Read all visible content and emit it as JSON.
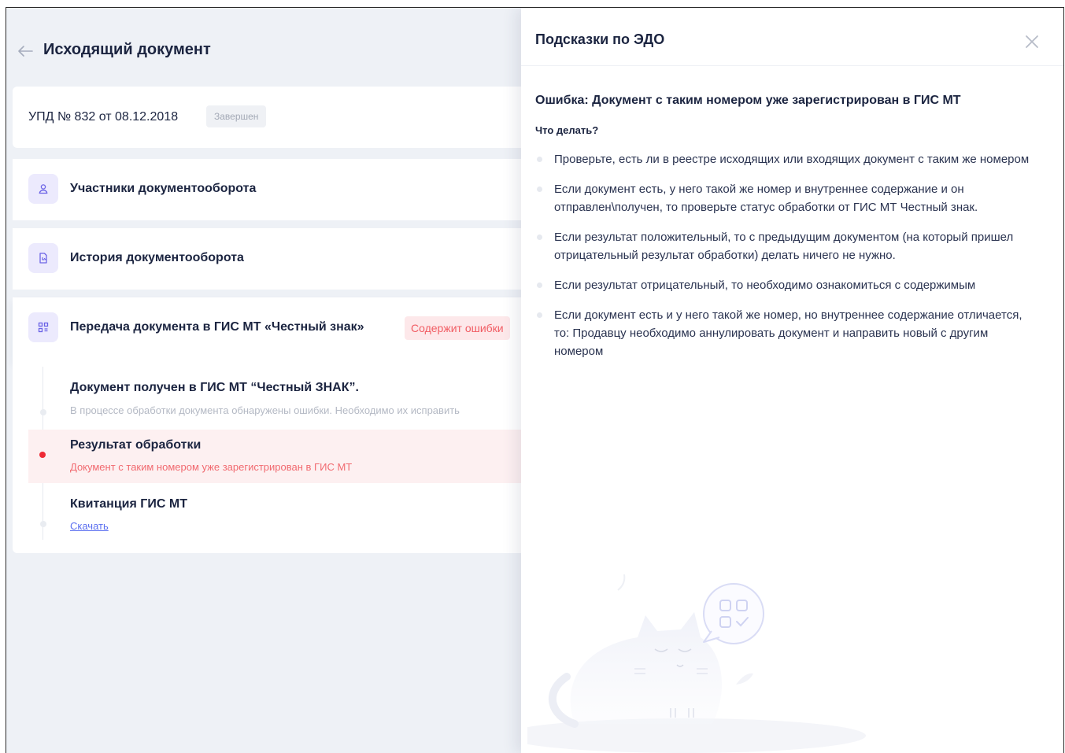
{
  "header": {
    "title": "Исходящий документ"
  },
  "document": {
    "number": "УПД № 832 от 08.12.2018",
    "status": "Завершен"
  },
  "sections": [
    {
      "label": "Участники документооборота",
      "icon": "user-icon"
    },
    {
      "label": "История документооборота",
      "icon": "document-history-icon"
    },
    {
      "label": "Передача документа в ГИС МТ «Честный знак»",
      "icon": "qr-code-icon",
      "badge": "Содержит ошибки"
    }
  ],
  "steps": [
    {
      "title": "Документ получен в ГИС МТ “Честный ЗНАК”.",
      "subtitle": "В процессе обработки документа обнаружены ошибки. Необходимо их исправить"
    },
    {
      "title": "Результат обработки",
      "subtitle": "Документ с таким номером уже  зарегистрирован в ГИС МТ"
    },
    {
      "title": "Квитанция ГИС МТ",
      "link": "Скачать"
    }
  ],
  "hints": {
    "title": "Подсказки по ЭДО",
    "error": "Ошибка: Документ с таким номером уже  зарегистрирован в ГИС МТ",
    "what_to_do": "Что делать?",
    "tips": [
      "Проверьте, есть ли в реестре исходящих или входящих документ с таким же номером",
      "Если документ есть, у него такой же номер и внутреннее содержание и он отправлен\\получен, то проверьте статус обработки от ГИС МТ Честный знак.",
      "Если результат положительный, то с предыдущим документом (на который пришел отрицательный результат обработки) делать ничего не нужно.",
      "Если результат отрицательный, то необходимо ознакомиться с содержимым",
      "Если документ есть и у него такой же номер, но внутреннее содержание отличается, то: Продавцу необходимо аннулировать документ и направить новый с другим номером"
    ]
  },
  "colors": {
    "accent": "#5a6ef0",
    "error": "#ee2a35",
    "text": "#1b2440",
    "background": "#eef1f6"
  }
}
